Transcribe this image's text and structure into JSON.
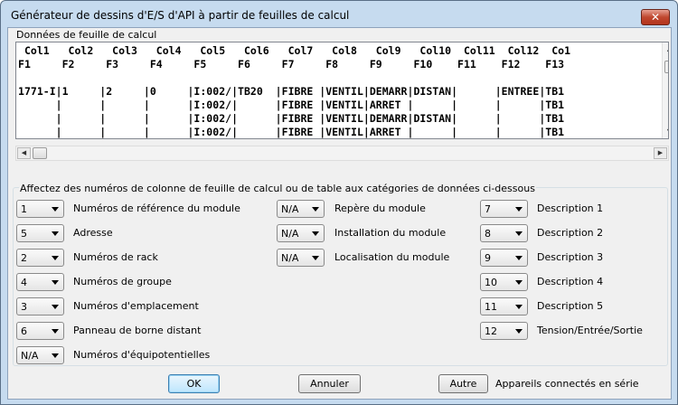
{
  "window": {
    "title": "Générateur de dessins d'E/S d'API à partir de feuilles de calcul",
    "close_glyph": "✕"
  },
  "sheet": {
    "label": "Données de feuille de calcul",
    "lines": [
      " Col1   Col2   Col3   Col4   Col5   Col6   Col7   Col8   Col9   Col10  Col11  Col12  Co1",
      "F1     F2     F3     F4     F5     F6     F7     F8     F9     F10    F11    F12    F13",
      "",
      "1771-I|1     |2     |0     |I:002/|TB20  |FIBRE |VENTIL|DEMARR|DISTAN|      |ENTREE|TB1",
      "      |      |      |      |I:002/|      |FIBRE |VENTIL|ARRET |      |      |      |TB1",
      "      |      |      |      |I:002/|      |FIBRE |VENTIL|DEMARR|DISTAN|      |      |TB1",
      "      |      |      |      |I:002/|      |FIBRE |VENTIL|ARRET |      |      |      |TB1"
    ]
  },
  "assign": {
    "label": "Affectez des numéros de colonne de feuille de calcul ou de table aux catégories de données ci-dessous",
    "col1": [
      {
        "value": "1",
        "label": "Numéros de référence du module"
      },
      {
        "value": "5",
        "label": "Adresse"
      },
      {
        "value": "2",
        "label": "Numéros de rack"
      },
      {
        "value": "4",
        "label": "Numéros de groupe"
      },
      {
        "value": "3",
        "label": "Numéros d'emplacement"
      },
      {
        "value": "6",
        "label": "Panneau de borne distant"
      },
      {
        "value": "N/A",
        "label": "Numéros d'équipotentielles"
      }
    ],
    "col2": [
      {
        "value": "N/A",
        "label": "Repère du module"
      },
      {
        "value": "N/A",
        "label": "Installation du module"
      },
      {
        "value": "N/A",
        "label": "Localisation du module"
      }
    ],
    "col3": [
      {
        "value": "7",
        "label": "Description 1"
      },
      {
        "value": "8",
        "label": "Description 2"
      },
      {
        "value": "9",
        "label": "Description 3"
      },
      {
        "value": "10",
        "label": "Description 4"
      },
      {
        "value": "11",
        "label": "Description 5"
      },
      {
        "value": "12",
        "label": "Tension/Entrée/Sortie"
      }
    ]
  },
  "buttons": {
    "ok": "OK",
    "cancel": "Annuler",
    "other": "Autre",
    "other_label": "Appareils connectés en série"
  }
}
